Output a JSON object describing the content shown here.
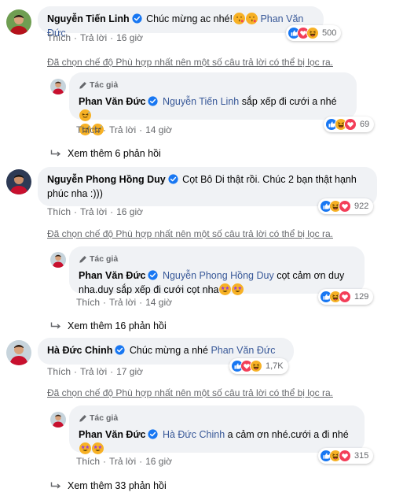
{
  "labels": {
    "like": "Thích",
    "reply": "Trả lời",
    "author": "Tác giả",
    "sep": "·"
  },
  "comments": [
    {
      "name": "Nguyễn Tiến Linh",
      "text": "Chúc mừng ac nhé!",
      "mention": "Phan Văn Đức",
      "time": "16 giờ",
      "reactions": "500",
      "reaction_icons": [
        "like-icon",
        "love-icon",
        "haha-icon"
      ],
      "notice": "Đã chọn chế độ Phù hợp nhất nên một số câu trả lời có thể bị lọc ra.",
      "reply": {
        "name": "Phan Văn Đức",
        "mention": "Nguyễn Tiến Linh",
        "text": "sắp xếp đi cưới a nhé",
        "time": "14 giờ",
        "reactions": "69",
        "reaction_icons": [
          "like-icon",
          "haha-icon",
          "love-icon"
        ]
      },
      "more": "Xem thêm 6 phản hồi"
    },
    {
      "name": "Nguyễn Phong Hồng Duy",
      "text_line1": "Cọt Bô Di thật rồi. Chúc 2 bạn thật hạnh",
      "text_line2": "phúc nha :)))",
      "time": "16 giờ",
      "reactions": "922",
      "reaction_icons": [
        "like-icon",
        "haha-icon",
        "love-icon"
      ],
      "notice": "Đã chọn chế độ Phù hợp nhất nên một số câu trả lời có thể bị lọc ra.",
      "reply": {
        "name": "Phan Văn Đức",
        "mention": "Nguyễn Phong Hồng Duy",
        "text": "cọt cảm ơn duy",
        "text_line2": "nha.duy sắp xếp đi cưới cọt nha",
        "time": "14 giờ",
        "reactions": "129",
        "reaction_icons": [
          "like-icon",
          "haha-icon",
          "love-icon"
        ]
      },
      "more": "Xem thêm 16 phản hồi"
    },
    {
      "name": "Hà Đức Chinh",
      "text": "Chúc mừng a nhé",
      "mention": "Phan Văn Đức",
      "time": "17 giờ",
      "reactions": "1,7K",
      "reaction_icons": [
        "like-icon",
        "love-icon",
        "haha-icon"
      ],
      "notice": "Đã chọn chế độ Phù hợp nhất nên một số câu trả lời có thể bị lọc ra.",
      "reply": {
        "name": "Phan Văn Đức",
        "mention": "Hà Đức Chinh",
        "text": "a cảm ơn nhé.cưới a đi nhé",
        "time": "16 giờ",
        "reactions": "315",
        "reaction_icons": [
          "like-icon",
          "haha-icon",
          "love-icon"
        ]
      },
      "more": "Xem thêm 33 phản hồi"
    }
  ],
  "colors": {
    "mention": "#385898",
    "bubble": "#f0f2f5",
    "like": "#1877f2",
    "love": "#f33e58",
    "haha": "#f7b125",
    "secondary": "#65676b"
  }
}
